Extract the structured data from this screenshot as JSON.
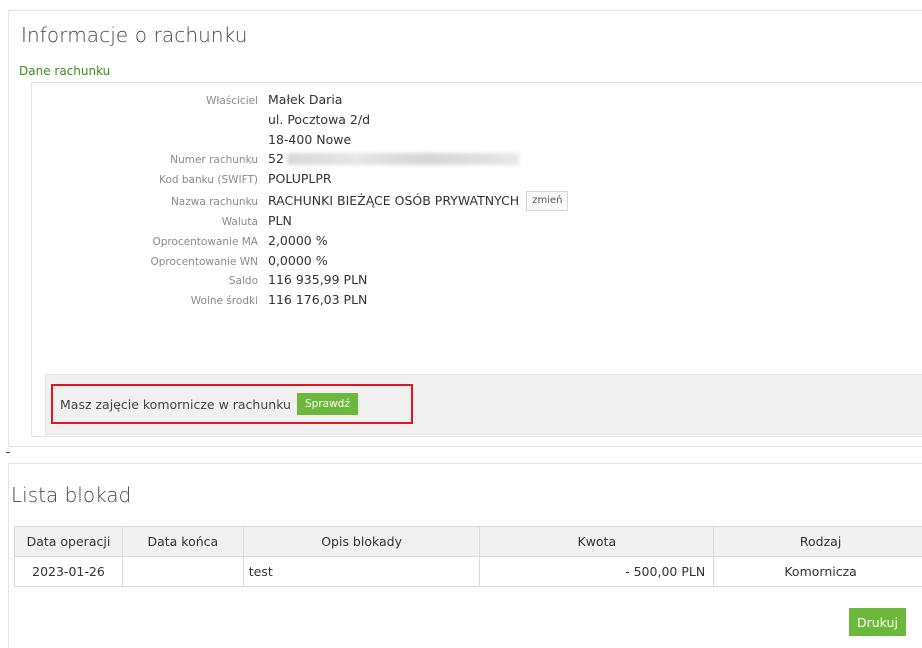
{
  "account_info": {
    "title": "Informacje o rachunku",
    "subtitle": "Dane rachunku",
    "rows": [
      {
        "label": "Właściciel",
        "value": "Małek Daria"
      },
      {
        "label": "",
        "value": "ul. Pocztowa 2/d"
      },
      {
        "label": "",
        "value": "18-400 Nowe"
      },
      {
        "label": "Numer rachunku",
        "value": "52"
      },
      {
        "label": "Kod banku (SWIFT)",
        "value": "POLUPLPR"
      },
      {
        "label": "Nazwa rachunku",
        "value": "RACHUNKI BIEŻĄCE OSÓB PRYWATNYCH"
      },
      {
        "label": "Waluta",
        "value": "PLN"
      },
      {
        "label": "Oprocentowanie MA",
        "value": "2,0000 %"
      },
      {
        "label": "Oprocentowanie WN",
        "value": "0,0000 %"
      },
      {
        "label": "Saldo",
        "value": "116 935,99 PLN"
      },
      {
        "label": "Wolne środki",
        "value": "116 176,03 PLN"
      }
    ],
    "change_button": "zmień",
    "alert_text": "Masz zajęcie komornicze w rachunku",
    "check_button": "Sprawdź"
  },
  "locks": {
    "title": "Lista blokad",
    "columns": [
      "Data operacji",
      "Data końca",
      "Opis blokady",
      "Kwota",
      "Rodzaj"
    ],
    "rows": [
      {
        "date": "2023-01-26",
        "end_date": "",
        "description": "test",
        "amount": "- 500,00 PLN",
        "type": "Komornicza"
      }
    ],
    "print_button": "Drukuj"
  },
  "colors": {
    "accent_green": "#6bb83a",
    "alert_red": "#e0171f",
    "subtitle_green": "#3d8c1e"
  }
}
